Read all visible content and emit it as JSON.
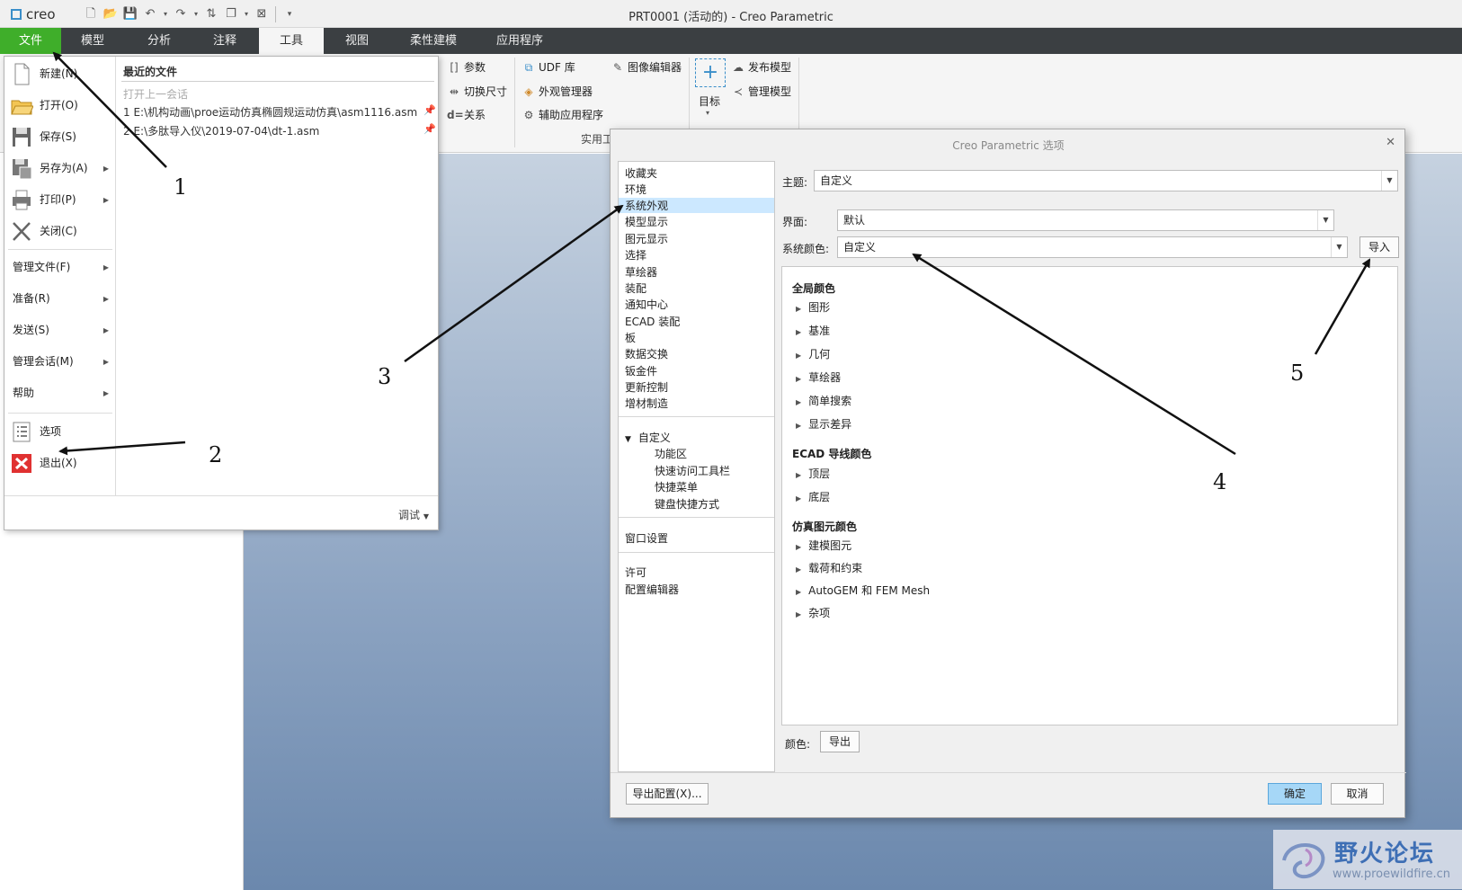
{
  "window": {
    "app_logo": "creo",
    "title": "PRT0001 (活动的) - Creo Parametric"
  },
  "ribbon_tabs": [
    "文件",
    "模型",
    "分析",
    "注释",
    "工具",
    "视图",
    "柔性建模",
    "应用程序"
  ],
  "ribbon": {
    "params": "参数",
    "toggle_dims": "切换尺寸",
    "relations": "关系",
    "udf_lib": "UDF 库",
    "appearance_mgr": "外观管理器",
    "aux_apps": "辅助应用程序",
    "image_editor": "图像编辑器",
    "target": "目标",
    "publish_model": "发布模型",
    "manage_model": "管理模型",
    "group_utilities": "实用工"
  },
  "file_menu": {
    "left_items": [
      {
        "label": "新建(N)",
        "icon": "new-file-icon"
      },
      {
        "label": "打开(O)",
        "icon": "open-folder-icon"
      },
      {
        "label": "保存(S)",
        "icon": "save-icon"
      },
      {
        "label": "另存为(A)",
        "icon": "save-as-icon",
        "submenu": true
      },
      {
        "label": "打印(P)",
        "icon": "print-icon",
        "submenu": true
      },
      {
        "label": "关闭(C)",
        "icon": "close-window-icon"
      }
    ],
    "mid_items": [
      "管理文件(F)",
      "准备(R)",
      "发送(S)",
      "管理会话(M)",
      "帮助"
    ],
    "bottom_items": [
      {
        "label": "选项",
        "icon": "options-list-icon"
      },
      {
        "label": "退出(X)",
        "icon": "exit-icon"
      }
    ],
    "recent_title": "最近的文件",
    "open_last_session": "打开上一会话",
    "recent_files": [
      "1 E:\\机构动画\\proe运动仿真椭圆规运动仿真\\asm1116.asm",
      "2 E:\\多肽导入仪\\2019-07-04\\dt-1.asm"
    ],
    "debug": "调试"
  },
  "dialog": {
    "title": "Creo Parametric 选项",
    "nav_items": [
      "收藏夹",
      "环境",
      "系统外观",
      "模型显示",
      "图元显示",
      "选择",
      "草绘器",
      "装配",
      "通知中心",
      "ECAD 装配",
      "板",
      "数据交换",
      "钣金件",
      "更新控制",
      "增材制造"
    ],
    "nav_custom": "自定义",
    "nav_custom_sub": [
      "功能区",
      "快速访问工具栏",
      "快捷菜单",
      "键盘快捷方式"
    ],
    "nav_window": "窗口设置",
    "nav_bottom": [
      "许可",
      "配置编辑器"
    ],
    "theme_label": "主题:",
    "theme_value": "自定义",
    "ui_label": "界面:",
    "ui_value": "默认",
    "syscolor_label": "系统颜色:",
    "syscolor_value": "自定义",
    "import_btn": "导入",
    "global_colors": "全局颜色",
    "global_items": [
      "图形",
      "基准",
      "几何",
      "草绘器",
      "简单搜索",
      "显示差异"
    ],
    "ecad_colors": "ECAD 导线颜色",
    "ecad_items": [
      "顶层",
      "底层"
    ],
    "sim_colors": "仿真图元颜色",
    "sim_items": [
      "建模图元",
      "载荷和约束",
      "AutoGEM 和 FEM Mesh",
      "杂项"
    ],
    "color_label": "颜色:",
    "export_btn": "导出",
    "export_config_btn": "导出配置(X)...",
    "ok_btn": "确定",
    "cancel_btn": "取消"
  },
  "annotations": [
    "1",
    "2",
    "3",
    "4",
    "5"
  ],
  "watermark": {
    "text": "野火论坛",
    "url": "www.proewildfire.cn"
  },
  "colors": {
    "file_tab": "#3fae2a",
    "tabbar": "#3b3f42",
    "selected_nav": "#cce8ff",
    "primary_btn": "#a6d7f7"
  }
}
